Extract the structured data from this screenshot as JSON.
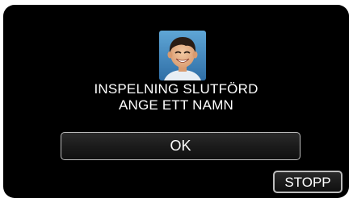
{
  "dialog": {
    "line1": "INSPELNING SLUTFÖRD",
    "line2": "ANGE ETT NAMN",
    "avatar_icon": "face-thumbnail"
  },
  "buttons": {
    "ok_label": "OK",
    "stop_label": "STOPP"
  },
  "colors": {
    "screen_bg": "#000000",
    "text": "#ffffff",
    "button_border": "#bdbdbd"
  }
}
